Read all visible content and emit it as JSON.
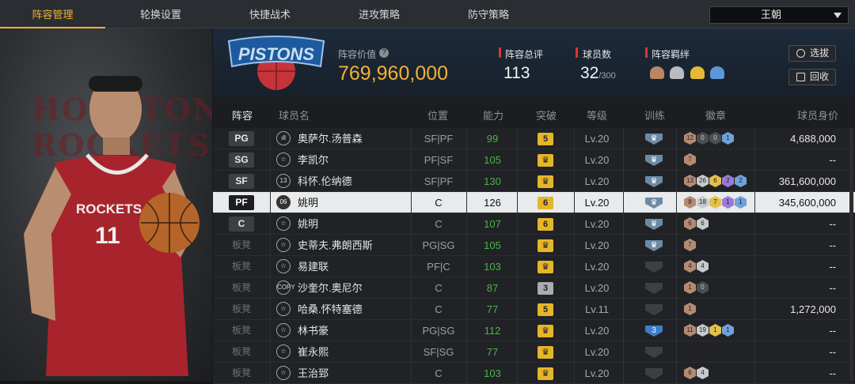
{
  "tabs": [
    "阵容管理",
    "轮换设置",
    "快捷战术",
    "进攻策略",
    "防守策略"
  ],
  "team_selector": "王朝",
  "team_logo": "PISTONS",
  "left_bg_text": "HOUSTON ROCKETS",
  "header": {
    "value_label": "阵容价值",
    "value": "769,960,000",
    "rating_label": "阵容总评",
    "rating": "113",
    "players_label": "球员数",
    "players": "32",
    "players_max": "/300",
    "bond_label": "阵容羁绊",
    "btn_select": "选拔",
    "btn_recycle": "回收"
  },
  "columns": [
    "阵容",
    "球员名",
    "位置",
    "能力",
    "突破",
    "等级",
    "训练",
    "徽章",
    "球员身价"
  ],
  "rows": [
    {
      "slot": "PG",
      "badge": "ıll",
      "name": "奥萨尔.汤普森",
      "position": "SF|PF",
      "ability": "99",
      "bt": "5",
      "level": "Lv.20",
      "train": "",
      "badges": [
        [
          "b",
          "12"
        ],
        [
          "d",
          "0"
        ],
        [
          "d",
          "0"
        ],
        [
          "l",
          "1"
        ]
      ],
      "value": "4,688,000"
    },
    {
      "slot": "SG",
      "badge": "☆",
      "name": "李凯尔",
      "position": "PF|SF",
      "ability": "105",
      "bt": "♛",
      "level": "Lv.20",
      "train": "",
      "badges": [
        [
          "b",
          "7"
        ]
      ],
      "value": "--"
    },
    {
      "slot": "SF",
      "badge": "13",
      "name": "科怀.伦纳德",
      "position": "SF|PF",
      "ability": "130",
      "bt": "♛",
      "level": "Lv.20",
      "train": "",
      "badges": [
        [
          "b",
          "13"
        ],
        [
          "s",
          "26"
        ],
        [
          "g",
          "6"
        ],
        [
          "p",
          "2"
        ],
        [
          "l",
          "2"
        ]
      ],
      "value": "361,600,000"
    },
    {
      "slot": "PF",
      "badge": "06",
      "name": "姚明",
      "position": "C",
      "ability": "126",
      "bt": "6",
      "level": "Lv.20",
      "train": "",
      "badges": [
        [
          "b",
          "8"
        ],
        [
          "s",
          "18"
        ],
        [
          "g",
          "7"
        ],
        [
          "p",
          "1"
        ],
        [
          "l",
          "1"
        ]
      ],
      "value": "345,600,000",
      "selected": true
    },
    {
      "slot": "C",
      "badge": "☆",
      "name": "姚明",
      "position": "C",
      "ability": "107",
      "bt": "6",
      "level": "Lv.20",
      "train": "",
      "badges": [
        [
          "b",
          "6"
        ],
        [
          "s",
          "6"
        ]
      ],
      "value": "--"
    },
    {
      "slot": "板凳",
      "badge": "☆",
      "name": "史蒂夫.弗朗西斯",
      "position": "PG|SG",
      "ability": "105",
      "bt": "♛",
      "level": "Lv.20",
      "train": "",
      "badges": [
        [
          "b",
          "7"
        ]
      ],
      "value": "--"
    },
    {
      "slot": "板凳",
      "badge": "☆",
      "name": "易建联",
      "position": "PF|C",
      "ability": "103",
      "bt": "♛",
      "level": "Lv.20",
      "train": "dark",
      "badges": [
        [
          "b",
          "4"
        ],
        [
          "s",
          "4"
        ]
      ],
      "value": "--"
    },
    {
      "slot": "板凳",
      "badge": "COPY",
      "name": "沙奎尔.奥尼尔",
      "position": "C",
      "ability": "87",
      "bt": "3",
      "level": "Lv.20",
      "train": "dark",
      "badges": [
        [
          "b",
          "1"
        ],
        [
          "d",
          "0"
        ]
      ],
      "value": "--"
    },
    {
      "slot": "板凳",
      "badge": "☆",
      "name": "哈桑.怀特塞德",
      "position": "C",
      "ability": "77",
      "bt": "5",
      "level": "Lv.11",
      "train": "dark",
      "badges": [
        [
          "b",
          "1"
        ]
      ],
      "value": "1,272,000"
    },
    {
      "slot": "板凳",
      "badge": "☆",
      "name": "林书豪",
      "position": "PG|SG",
      "ability": "112",
      "bt": "♛",
      "level": "Lv.20",
      "train": "blue3",
      "badges": [
        [
          "b",
          "11"
        ],
        [
          "s",
          "19"
        ],
        [
          "g",
          "1"
        ],
        [
          "l",
          "1"
        ]
      ],
      "value": "--"
    },
    {
      "slot": "板凳",
      "badge": "☆",
      "name": "崔永熙",
      "position": "SF|SG",
      "ability": "77",
      "bt": "♛",
      "level": "Lv.20",
      "train": "dark",
      "badges": [],
      "value": "--"
    },
    {
      "slot": "板凳",
      "badge": "☆",
      "name": "王治郅",
      "position": "C",
      "ability": "103",
      "bt": "♛",
      "level": "Lv.20",
      "train": "dark",
      "badges": [
        [
          "b",
          "6"
        ],
        [
          "s",
          "4"
        ]
      ],
      "value": "--"
    }
  ]
}
